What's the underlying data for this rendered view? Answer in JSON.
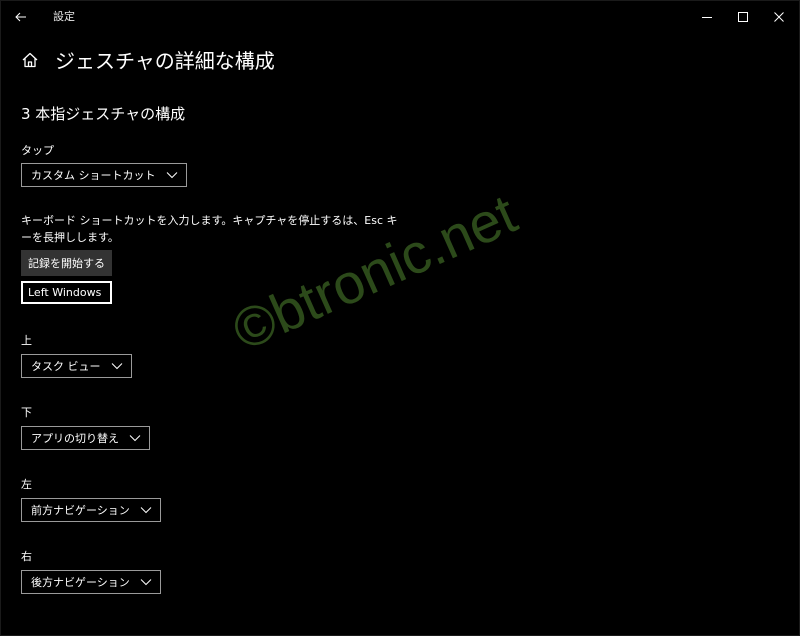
{
  "window": {
    "title": "設定"
  },
  "header": {
    "page_title": "ジェスチャの詳細な構成"
  },
  "section": {
    "title": "3 本指ジェスチャの構成"
  },
  "tap": {
    "label": "タップ",
    "selected": "カスタム ショートカット"
  },
  "shortcut": {
    "description": "キーボード ショートカットを入力します。キャプチャを停止するは、Esc キーを長押しします。",
    "record_button": "記録を開始する",
    "key_value": "Left Windows"
  },
  "up": {
    "label": "上",
    "selected": "タスク ビュー"
  },
  "down": {
    "label": "下",
    "selected": "アプリの切り替え"
  },
  "left": {
    "label": "左",
    "selected": "前方ナビゲーション"
  },
  "right": {
    "label": "右",
    "selected": "後方ナビゲーション"
  },
  "watermark": "©btronic.net",
  "icons": {
    "back": "back-arrow-icon",
    "minimize": "minimize-icon",
    "maximize": "maximize-icon",
    "close": "close-icon",
    "home": "home-icon",
    "chevron": "chevron-down-icon"
  }
}
